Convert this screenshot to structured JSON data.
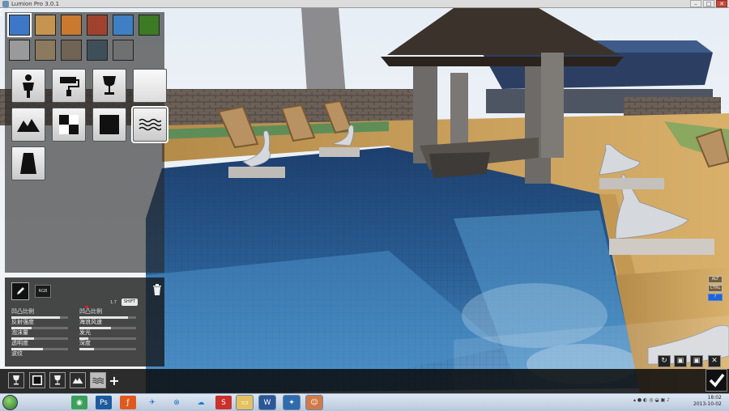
{
  "window": {
    "title": "Lumion Pro 3.0.1",
    "controls": [
      "–",
      "□",
      "✕"
    ]
  },
  "material_panel": {
    "swatches_row1": [
      "#3d78c8",
      "#c49450",
      "#c97a30",
      "#a0432e",
      "#3f7fc4",
      "#3c7a24"
    ],
    "swatches_row2": [
      "#9a9a9a",
      "#8c7a5e",
      "#6f6455",
      "#3f4f5a",
      "#707070"
    ],
    "tools": [
      {
        "name": "person-icon"
      },
      {
        "name": "paint-roller-icon"
      },
      {
        "name": "glass-icon"
      },
      {
        "name": "standard-material-icon"
      },
      {
        "name": "landscape-icon"
      },
      {
        "name": "checker-icon"
      },
      {
        "name": "black-square-icon"
      },
      {
        "name": "water-waves-icon",
        "selected": true
      },
      {
        "name": "fabric-icon"
      }
    ]
  },
  "properties": {
    "rgb_label": "RGB",
    "value": "1.7",
    "shift_label": "SHIFT",
    "sliders": [
      {
        "label": "凹凸比例",
        "value": 0.85
      },
      {
        "label": "凹凸比例",
        "value": 0.85
      },
      {
        "label": "反射强度",
        "value": 0.35
      },
      {
        "label": "海浪风速",
        "value": 0.55
      },
      {
        "label": "泡沫量",
        "value": 0.4
      },
      {
        "label": "发光",
        "value": 0.15
      },
      {
        "label": "透明度",
        "value": 0.55
      },
      {
        "label": "深度",
        "value": 0.25
      },
      {
        "label": "波纹",
        "value": 0.3
      }
    ]
  },
  "bottom_toolbar": {
    "icons": [
      "glass-icon",
      "black-square-icon",
      "glass-icon",
      "landscape-icon",
      "water-waves-icon",
      "plus-icon"
    ]
  },
  "right_controls": {
    "kbd_labels": [
      "ALT",
      "CTRL",
      "?"
    ],
    "actions": [
      "reload-icon",
      "save-icon",
      "save-as-icon",
      "close-icon"
    ]
  },
  "taskbar": {
    "apps": [
      "chrome-icon",
      "photoshop-icon",
      "flash-icon",
      "bird-icon",
      "network-icon",
      "cloud-icon",
      "sketchup-icon",
      "folder-icon",
      "word-icon",
      "lumion-icon",
      "people-icon"
    ],
    "time": "18:02",
    "date": "2013-10-02"
  }
}
